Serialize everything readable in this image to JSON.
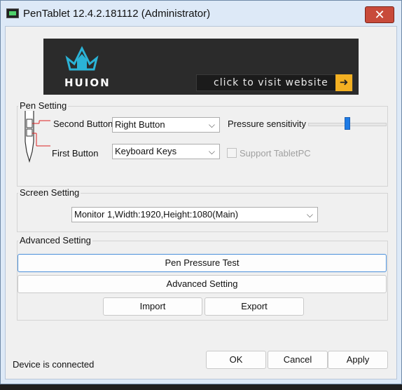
{
  "window": {
    "title": "PenTablet 12.4.2.181112 (Administrator)",
    "close_glyph": "✕"
  },
  "banner": {
    "logo_text": "HUION",
    "visit_text": "click to visit website",
    "arrow_glyph": "➜"
  },
  "pen_setting": {
    "group_label": "Pen Setting",
    "second_button_label": "Second Button",
    "second_button_value": "Right Button",
    "first_button_label": "First Button",
    "first_button_value": "Keyboard Keys",
    "pressure_label": "Pressure sensitivity",
    "pressure_level": 0.5,
    "support_tabletpc_label": "Support TabletPC",
    "support_tabletpc_checked": false
  },
  "screen_setting": {
    "group_label": "Screen Setting",
    "monitor_value": "Monitor 1,Width:1920,Height:1080(Main)"
  },
  "advanced_setting": {
    "group_label": "Advanced Setting",
    "pen_pressure_test_label": "Pen Pressure Test",
    "advanced_setting_button_label": "Advanced Setting",
    "import_label": "Import",
    "export_label": "Export"
  },
  "footer": {
    "status_text": "Device is connected",
    "ok_label": "OK",
    "cancel_label": "Cancel",
    "apply_label": "Apply"
  },
  "colors": {
    "title_bg": "#dde9f7",
    "close_red": "#c84a3a",
    "banner_bg": "#2b2b2b",
    "logo_cyan": "#2bb3d6",
    "arrow_orange": "#f3b022",
    "slider_blue": "#1e7be5"
  },
  "chevron_glyph": "⌵"
}
